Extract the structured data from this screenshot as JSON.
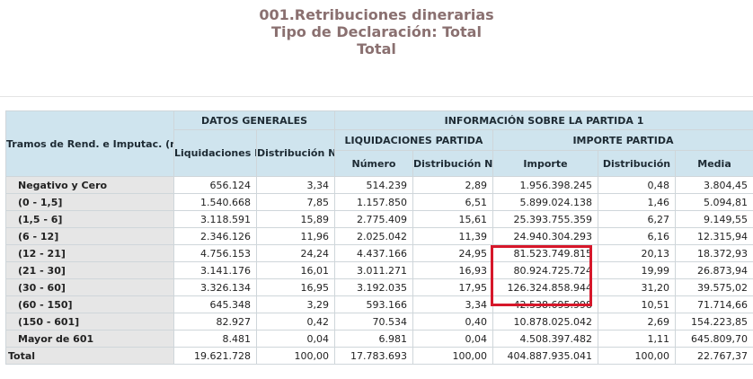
{
  "title": {
    "line1": "001.Retribuciones dinerarias",
    "line2": "Tipo de Declaración: Total",
    "line3": "Total"
  },
  "headers": {
    "row_header": "Tramos de Rend. e Imputac. (miles de euros)",
    "datos_generales": "DATOS GENERALES",
    "info_partida": "INFORMACIÓN SOBRE LA PARTIDA 1",
    "liq_numero_total": "Liquidaciones Número Total",
    "distribucion_numero": "Distribución Número",
    "liq_partida": "LIQUIDACIONES PARTIDA",
    "importe_partida": "IMPORTE PARTIDA",
    "numero": "Número",
    "distribucion_numero_2": "Distribución Número",
    "importe": "Importe",
    "distribucion": "Distribución",
    "media": "Media"
  },
  "rows": [
    {
      "tramo": "Negativo y Cero",
      "liq_total": "656.124",
      "dist_num": "3,34",
      "numero": "514.239",
      "dist_num2": "2,89",
      "importe": "1.956.398.245",
      "distribucion": "0,48",
      "media": "3.804,45"
    },
    {
      "tramo": "(0 - 1,5]",
      "liq_total": "1.540.668",
      "dist_num": "7,85",
      "numero": "1.157.850",
      "dist_num2": "6,51",
      "importe": "5.899.024.138",
      "distribucion": "1,46",
      "media": "5.094,81"
    },
    {
      "tramo": "(1,5 - 6]",
      "liq_total": "3.118.591",
      "dist_num": "15,89",
      "numero": "2.775.409",
      "dist_num2": "15,61",
      "importe": "25.393.755.359",
      "distribucion": "6,27",
      "media": "9.149,55"
    },
    {
      "tramo": "(6 - 12]",
      "liq_total": "2.346.126",
      "dist_num": "11,96",
      "numero": "2.025.042",
      "dist_num2": "11,39",
      "importe": "24.940.304.293",
      "distribucion": "6,16",
      "media": "12.315,94"
    },
    {
      "tramo": "(12 - 21]",
      "liq_total": "4.756.153",
      "dist_num": "24,24",
      "numero": "4.437.166",
      "dist_num2": "24,95",
      "importe": "81.523.749.815",
      "distribucion": "20,13",
      "media": "18.372,93"
    },
    {
      "tramo": "(21 - 30]",
      "liq_total": "3.141.176",
      "dist_num": "16,01",
      "numero": "3.011.271",
      "dist_num2": "16,93",
      "importe": "80.924.725.724",
      "distribucion": "19,99",
      "media": "26.873,94"
    },
    {
      "tramo": "(30 - 60]",
      "liq_total": "3.326.134",
      "dist_num": "16,95",
      "numero": "3.192.035",
      "dist_num2": "17,95",
      "importe": "126.324.858.944",
      "distribucion": "31,20",
      "media": "39.575,02"
    },
    {
      "tramo": "(60 - 150]",
      "liq_total": "645.348",
      "dist_num": "3,29",
      "numero": "593.166",
      "dist_num2": "3,34",
      "importe": "42.538.695.998",
      "distribucion": "10,51",
      "media": "71.714,66"
    },
    {
      "tramo": "(150 - 601]",
      "liq_total": "82.927",
      "dist_num": "0,42",
      "numero": "70.534",
      "dist_num2": "0,40",
      "importe": "10.878.025.042",
      "distribucion": "2,69",
      "media": "154.223,85"
    },
    {
      "tramo": "Mayor de 601",
      "liq_total": "8.481",
      "dist_num": "0,04",
      "numero": "6.981",
      "dist_num2": "0,04",
      "importe": "4.508.397.482",
      "distribucion": "1,11",
      "media": "645.809,70"
    },
    {
      "tramo": "Total",
      "liq_total": "19.621.728",
      "dist_num": "100,00",
      "numero": "17.783.693",
      "dist_num2": "100,00",
      "importe": "404.887.935.041",
      "distribucion": "100,00",
      "media": "22.767,37"
    }
  ],
  "colors": {
    "title": "#8a7070",
    "header_bg": "#cfe4ee",
    "label_bg": "#e6e6e6",
    "highlight": "#d6172a"
  }
}
